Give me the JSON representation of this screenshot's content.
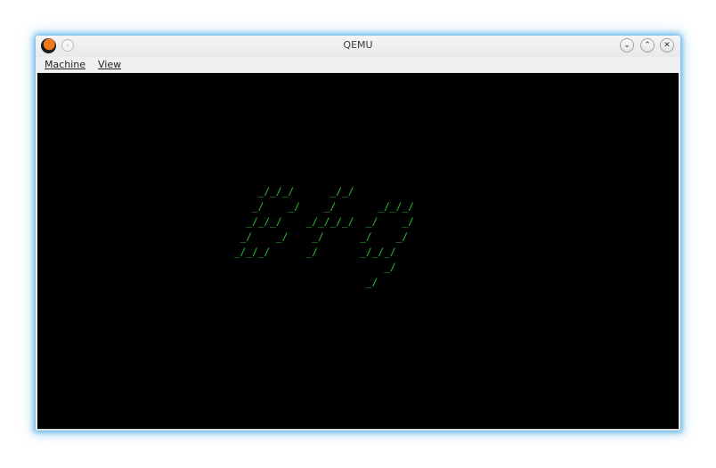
{
  "window": {
    "title": "QEMU",
    "app_icon": "qemu-icon",
    "pin_icon": "pin-icon",
    "buttons": {
      "minimize_glyph": "⌄",
      "maximize_glyph": "⌃",
      "close_glyph": "✕"
    }
  },
  "menu": {
    "items": [
      {
        "label": "Machine"
      },
      {
        "label": "View"
      }
    ]
  },
  "screen": {
    "background": "#000000",
    "text_color": "#2fbf2f",
    "ascii_art": "     _/_/_/      _/_/\n    _/    _/    _/       _/_/_/\n   _/_/_/    _/_/_/_/  _/    _/\n  _/    _/    _/      _/    _/\n _/_/_/      _/       _/_/_/\n                          _/\n                       _/"
  }
}
